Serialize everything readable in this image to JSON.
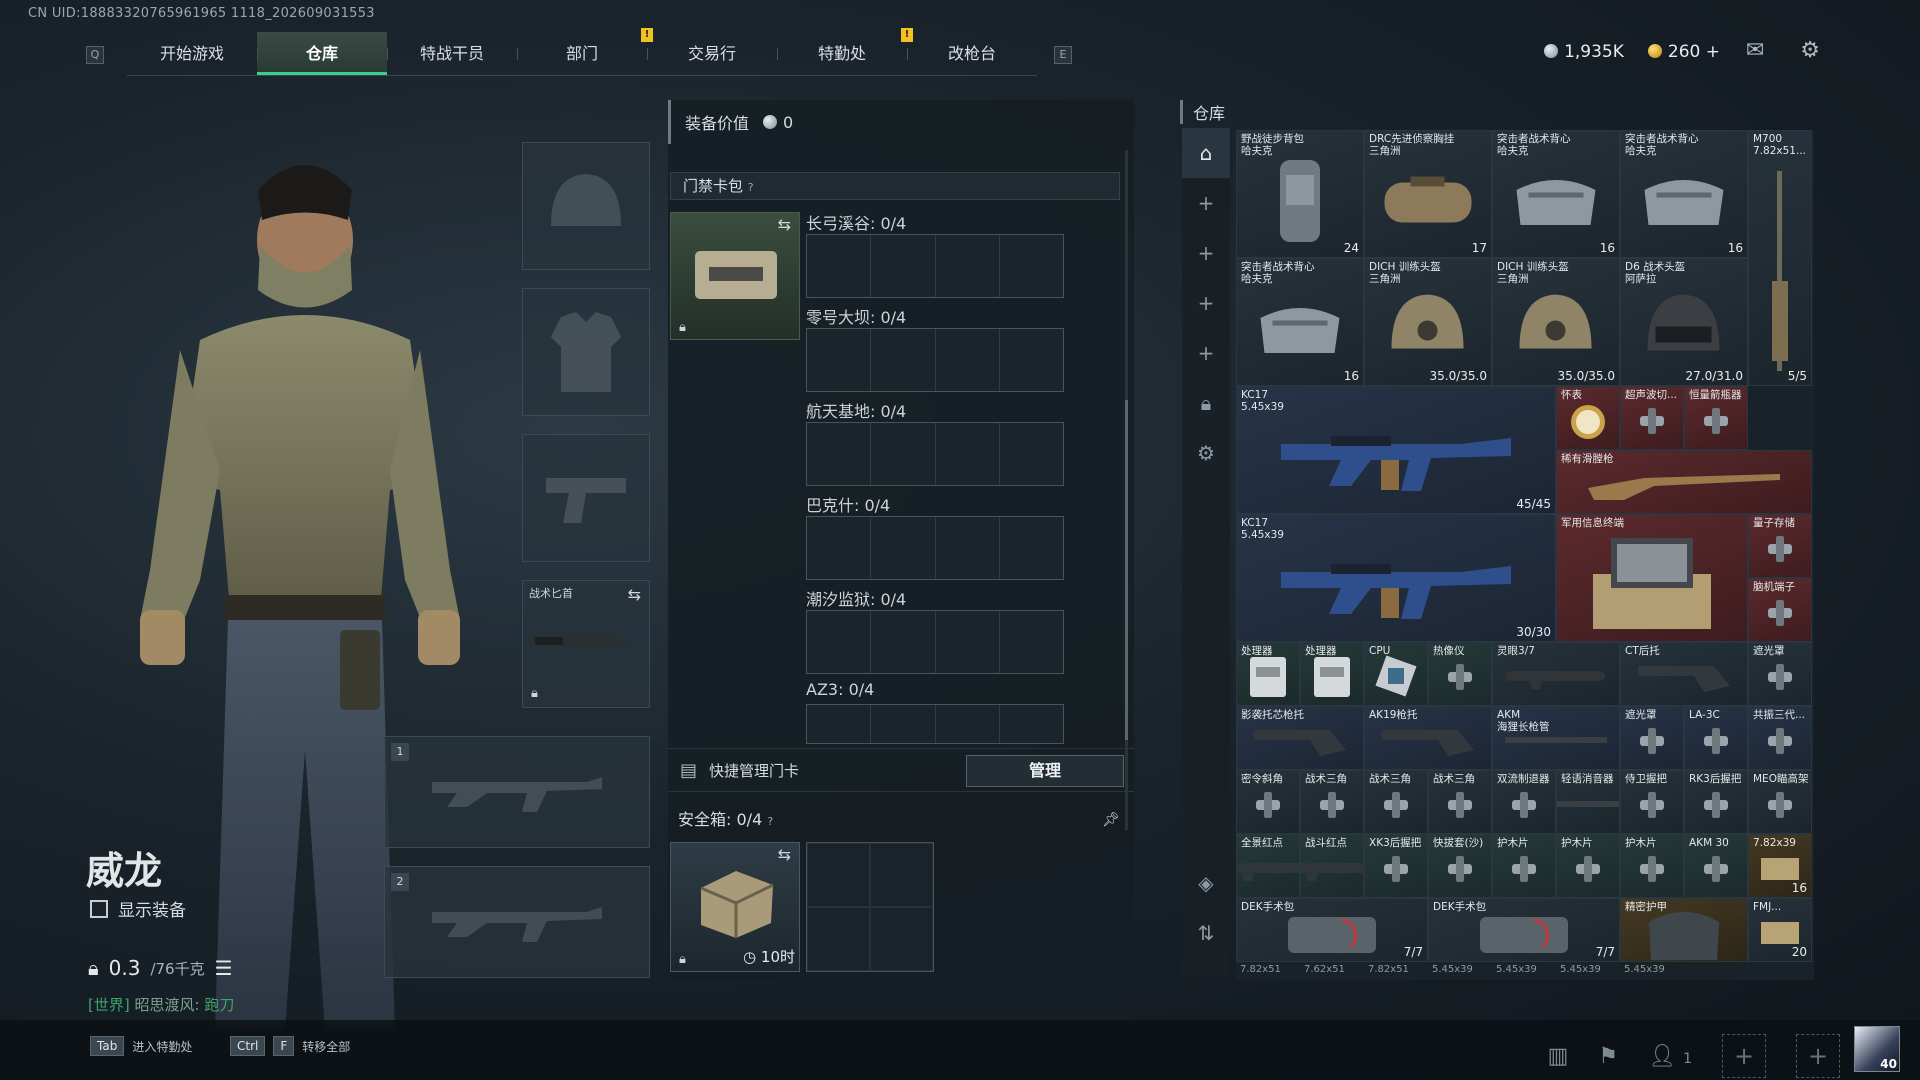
{
  "uid": "CN UID:18883320765961965 1118_202609031553",
  "nav": {
    "left_key": "Q",
    "right_key": "E",
    "tabs": [
      {
        "label": "开始游戏",
        "active": false,
        "warn": false
      },
      {
        "label": "仓库",
        "active": true,
        "warn": false
      },
      {
        "label": "特战干员",
        "active": false,
        "warn": false
      },
      {
        "label": "部门",
        "active": false,
        "warn": true
      },
      {
        "label": "交易行",
        "active": false,
        "warn": false
      },
      {
        "label": "特勤处",
        "active": false,
        "warn": true
      },
      {
        "label": "改枪台",
        "active": false,
        "warn": false
      }
    ],
    "warn_mark": "!"
  },
  "currency": {
    "silver": "1,935K",
    "gold": "260",
    "gold_plus": "+"
  },
  "character": {
    "name": "威龙",
    "show_equipment": "显示装备",
    "weight_current": "0.3",
    "weight_max": "/76千克",
    "chat_channel": "[世界]",
    "chat_user": "昭思渡风:",
    "chat_msg": "跑刀"
  },
  "slots": {
    "knife_label": "战术匕首",
    "slot1": "1",
    "slot2": "2"
  },
  "middle": {
    "equip_value_label": "装备价值",
    "equip_value": "0",
    "cardbag_label": "门禁卡包",
    "help": "?",
    "maps": [
      {
        "label": "长弓溪谷: 0/4"
      },
      {
        "label": "零号大坝: 0/4"
      },
      {
        "label": "航天基地: 0/4"
      },
      {
        "label": "巴克什: 0/4"
      },
      {
        "label": "潮汐监狱: 0/4"
      },
      {
        "label": "AZ3: 0/4"
      }
    ],
    "quick_manage": "快捷管理门卡",
    "manage_btn": "管理",
    "safe_label": "安全箱:",
    "safe_count": "0/4",
    "safe_timer": "10时"
  },
  "warehouse": {
    "title": "仓库",
    "items": [
      {
        "name": "野战徒步背包\n哈夫克",
        "count": "24",
        "tone": "",
        "art": "bag"
      },
      {
        "name": "DRC先进侦察胸挂\n三角洲",
        "count": "17",
        "tone": "",
        "art": "duffel"
      },
      {
        "name": "突击者战术背心\n哈夫克",
        "count": "16",
        "tone": "",
        "art": "vest"
      },
      {
        "name": "突击者战术背心\n哈夫克",
        "count": "16",
        "tone": "",
        "art": "vest"
      },
      {
        "name": "M700\n7.82x51...",
        "count": "5/5",
        "tone": "",
        "art": "rifle-v"
      },
      {
        "name": "突击者战术背心\n哈夫克",
        "count": "16",
        "tone": "",
        "art": "vest"
      },
      {
        "name": "DICH 训练头盔\n三角洲",
        "count": "35.0/35.0",
        "tone": "",
        "art": "helmet"
      },
      {
        "name": "DICH 训练头盔\n三角洲",
        "count": "35.0/35.0",
        "tone": "",
        "art": "helmet"
      },
      {
        "name": "D6 战术头盔\n阿萨拉",
        "count": "27.0/31.0",
        "tone": "",
        "art": "helmet-dark"
      },
      {
        "name": "KC17\n5.45x39",
        "count": "45/45",
        "tone": "blue",
        "art": "gun"
      },
      {
        "name": "怀表",
        "count": "",
        "tone": "red",
        "art": "watch"
      },
      {
        "name": "超声波切...",
        "count": "",
        "tone": "red",
        "art": "tool"
      },
      {
        "name": "恒量箭瓶器",
        "count": "",
        "tone": "red",
        "art": "tool"
      },
      {
        "name": "稀有滑膛枪",
        "count": "",
        "tone": "red",
        "art": "musket"
      },
      {
        "name": "KC17\n5.45x39",
        "count": "30/30",
        "tone": "blue",
        "art": "gun"
      },
      {
        "name": "军用信息终端",
        "count": "",
        "tone": "red",
        "art": "terminal"
      },
      {
        "name": "量子存储",
        "count": "",
        "tone": "red",
        "art": "tool"
      },
      {
        "name": "脑机端子",
        "count": "",
        "tone": "red",
        "art": "tool"
      },
      {
        "name": "处理器",
        "count": "",
        "tone": "green",
        "art": "box"
      },
      {
        "name": "处理器",
        "count": "",
        "tone": "green",
        "art": "box"
      },
      {
        "name": "CPU",
        "count": "",
        "tone": "green",
        "art": "chip"
      },
      {
        "name": "热像仪",
        "count": "",
        "tone": "green",
        "art": "tool"
      },
      {
        "name": "灵眼3/7",
        "count": "",
        "tone": "",
        "art": "scope"
      },
      {
        "name": "CT后托",
        "count": "",
        "tone": "",
        "art": "stock"
      },
      {
        "name": "遮光罩",
        "count": "",
        "tone": "",
        "art": "tool"
      },
      {
        "name": "影袭托芯枪托",
        "count": "",
        "tone": "blue",
        "art": "stock"
      },
      {
        "name": "AK19枪托",
        "count": "",
        "tone": "blue",
        "art": "stock"
      },
      {
        "name": "AKM\n海狸长枪管",
        "count": "",
        "tone": "blue",
        "art": "barrel"
      },
      {
        "name": "遮光罩",
        "count": "",
        "tone": "blue",
        "art": "tool"
      },
      {
        "name": "LA-3C",
        "count": "",
        "tone": "blue",
        "art": "tool"
      },
      {
        "name": "共振三代...",
        "count": "",
        "tone": "blue",
        "art": "tool"
      },
      {
        "name": "密令斜角",
        "count": "",
        "tone": "",
        "art": "tool"
      },
      {
        "name": "战术三角",
        "count": "",
        "tone": "",
        "art": "tool"
      },
      {
        "name": "战术三角",
        "count": "",
        "tone": "",
        "art": "tool"
      },
      {
        "name": "战术三角",
        "count": "",
        "tone": "",
        "art": "tool"
      },
      {
        "name": "双流制退器",
        "count": "",
        "tone": "",
        "art": "tool"
      },
      {
        "name": "轻语消音器",
        "count": "",
        "tone": "",
        "art": "barrel"
      },
      {
        "name": "侍卫握把",
        "count": "",
        "tone": "",
        "art": "tool"
      },
      {
        "name": "RK3后握把",
        "count": "",
        "tone": "",
        "art": "tool"
      },
      {
        "name": "MEO瞄高架",
        "count": "",
        "tone": "",
        "art": "tool"
      },
      {
        "name": "全景红点",
        "count": "",
        "tone": "green",
        "art": "scope"
      },
      {
        "name": "战斗红点",
        "count": "",
        "tone": "green",
        "art": "scope"
      },
      {
        "name": "XK3后握把",
        "count": "",
        "tone": "green",
        "art": "tool"
      },
      {
        "name": "快拔套(沙)",
        "count": "",
        "tone": "green",
        "art": "tool"
      },
      {
        "name": "护木片",
        "count": "",
        "tone": "green",
        "art": "tool"
      },
      {
        "name": "护木片",
        "count": "",
        "tone": "green",
        "art": "tool"
      },
      {
        "name": "护木片",
        "count": "",
        "tone": "green",
        "art": "tool"
      },
      {
        "name": "AKM 30",
        "count": "",
        "tone": "green",
        "art": "tool"
      },
      {
        "name": "7.82x39",
        "count": "16",
        "tone": "gold",
        "art": "ammo"
      },
      {
        "name": "DEK手术包",
        "count": "7/7",
        "tone": "",
        "art": "medkit"
      },
      {
        "name": "DEK手术包",
        "count": "7/7",
        "tone": "",
        "art": "medkit"
      },
      {
        "name": "精密护甲",
        "count": "",
        "tone": "gold",
        "art": "armor"
      },
      {
        "name": "FMJ...",
        "count": "20",
        "tone": "",
        "art": "ammo"
      }
    ],
    "bottom_tags": [
      "7.82x51",
      "7.62x51",
      "7.82x51",
      "5.45x39",
      "5.45x39",
      "5.45x39",
      "5.45x39"
    ]
  },
  "bottom": {
    "tab_key": "Tab",
    "tab_label": "进入特勤处",
    "ctrl_key": "Ctrl",
    "f_key": "F",
    "transfer_label": "转移全部",
    "friends": "1",
    "level": "40"
  }
}
